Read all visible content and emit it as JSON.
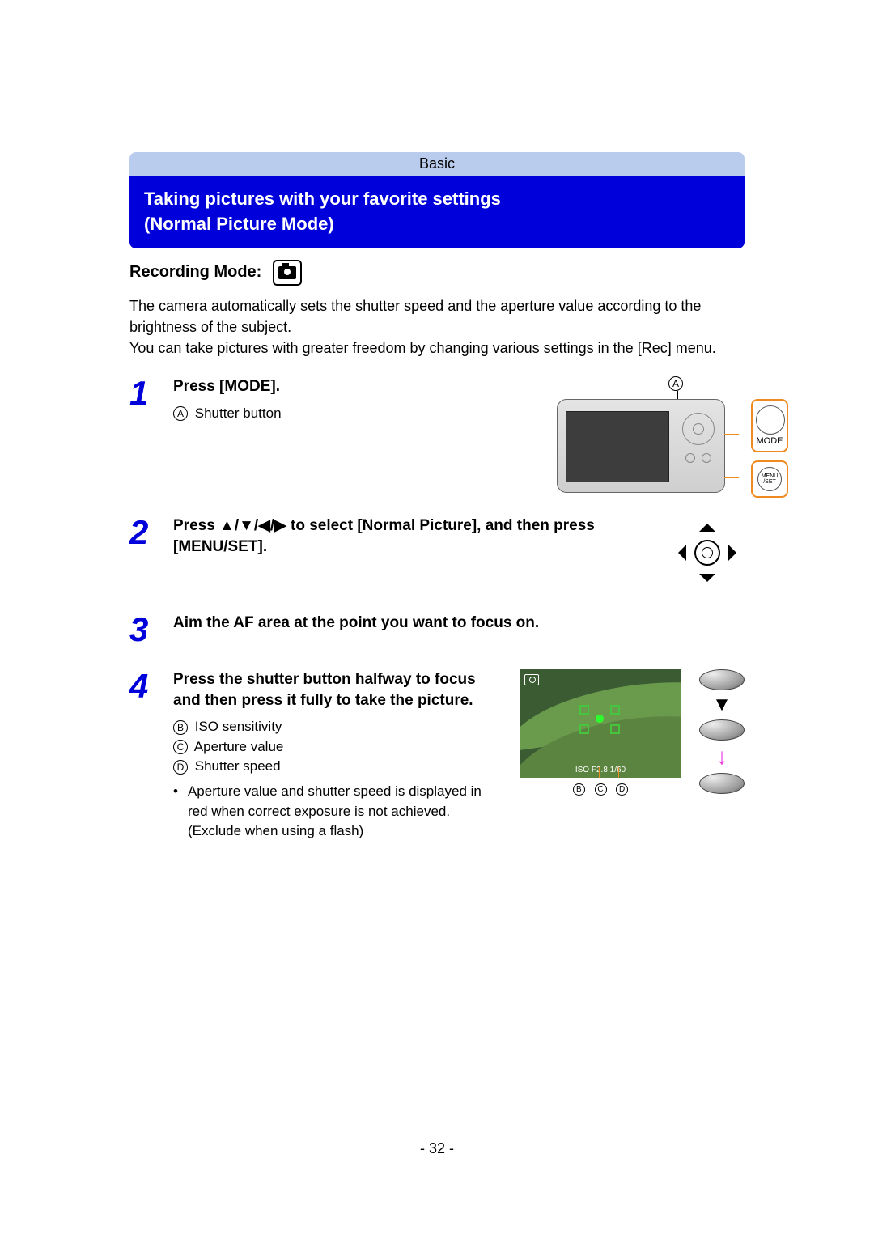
{
  "header": {
    "tab": "Basic",
    "title_line1": "Taking pictures with your favorite settings",
    "title_line2": "(Normal Picture Mode)"
  },
  "mode": {
    "label": "Recording Mode:",
    "icon": "camera-icon"
  },
  "intro": {
    "p1": "The camera automatically sets the shutter speed and the aperture value according to the brightness of the subject.",
    "p2": "You can take pictures with greater freedom by changing various settings in the [Rec] menu."
  },
  "steps": [
    {
      "num": "1",
      "head": "Press [MODE].",
      "sub_a": "Shutter button",
      "callout_a": "A",
      "mode_btn": "MODE",
      "menu_btn": "MENU\n/SET"
    },
    {
      "num": "2",
      "head": "Press ▲/▼/◀/▶ to select [Normal Picture], and then press [MENU/SET]."
    },
    {
      "num": "3",
      "head": "Aim the AF area at the point you want to focus on."
    },
    {
      "num": "4",
      "head": "Press the shutter button halfway to focus and then press it fully to take the picture.",
      "b_label": "B",
      "b_text": "ISO sensitivity",
      "c_label": "C",
      "c_text": "Aperture value",
      "d_label": "D",
      "d_text": "Shutter speed",
      "note": "Aperture value and shutter speed is displayed in red when correct exposure is not achieved. (Exclude when using a flash)",
      "lcd_readout": "ISO  F2.8  1/60"
    }
  ],
  "page_number": "- 32 -"
}
